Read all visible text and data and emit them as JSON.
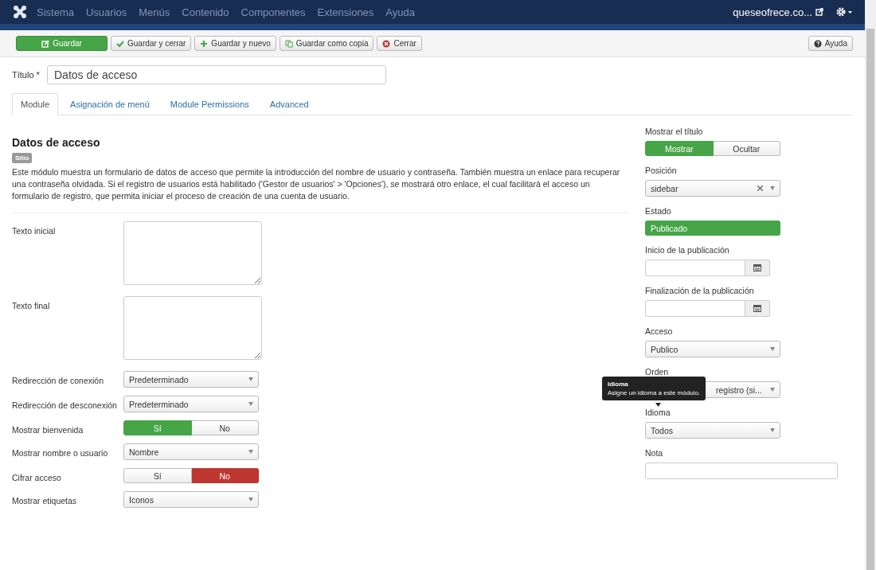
{
  "navbar": {
    "menu": [
      "Sistema",
      "Usuarios",
      "Menús",
      "Contenido",
      "Componentes",
      "Extensiones",
      "Ayuda"
    ],
    "site": "queseofrece.co..."
  },
  "toolbar": {
    "buttons": [
      {
        "label": "Guardar",
        "kind": "primary"
      },
      {
        "label": "Guardar y cerrar",
        "kind": "check"
      },
      {
        "label": "Guardar y nuevo",
        "kind": "plus"
      },
      {
        "label": "Guardar como copia",
        "kind": "copy"
      },
      {
        "label": "Cerrar",
        "kind": "close"
      }
    ],
    "help": "Ayuda"
  },
  "title_field": {
    "label": "Título *",
    "value": "Datos de acceso"
  },
  "tabs": [
    {
      "label": "Module",
      "selected": true
    },
    {
      "label": "Asignación de menú",
      "selected": false
    },
    {
      "label": "Module Permissions",
      "selected": false
    },
    {
      "label": "Advanced",
      "selected": false
    }
  ],
  "module": {
    "heading": "Datos de acceso",
    "badge": "Sitio",
    "description": "Este módulo muestra un formulario de datos de acceso que permite la introducción del nombre de usuario y contraseña. También muestra un enlace para recuperar una contraseña olvidada. Si el registro de usuarios está habilitado ('Gestor de usuarios' > 'Opciones'), se mostrará otro enlace, el cual facilitará el acceso un formulario de registro, que permita iniciar el proceso de creación de una cuenta de usuario."
  },
  "fields": [
    {
      "label": "Texto inicial",
      "kind": "textarea"
    },
    {
      "label": "Texto final",
      "kind": "textarea"
    },
    {
      "label": "Redirección de conexión",
      "kind": "select",
      "value": "Predeterminado"
    },
    {
      "label": "Redirección de desconexión",
      "kind": "select",
      "value": "Predeterminado"
    },
    {
      "label": "Mostrar bienvenida",
      "kind": "toggle",
      "color": "#46a546",
      "options": [
        {
          "label": "Sí",
          "selected": true
        },
        {
          "label": "No",
          "selected": false
        }
      ]
    },
    {
      "label": "Mostrar nombre o usuario",
      "kind": "select",
      "value": "Nombre"
    },
    {
      "label": "Cifrar acceso",
      "kind": "toggle",
      "color": "#bd362f",
      "options": [
        {
          "label": "Sí",
          "selected": false
        },
        {
          "label": "No",
          "selected": true
        }
      ]
    },
    {
      "label": "Mostrar etiquetas",
      "kind": "select",
      "value": "Iconos"
    }
  ],
  "sidebar": [
    {
      "label": "Mostrar el título",
      "kind": "toggle",
      "color": "#46a546",
      "options": [
        {
          "label": "Mostrar",
          "selected": true
        },
        {
          "label": "Ocultar",
          "selected": false
        }
      ]
    },
    {
      "label": "Posición",
      "kind": "select",
      "value": "sidebar",
      "clearable": true
    },
    {
      "label": "Estado",
      "kind": "status",
      "value": "Publicado",
      "color": "#46a546"
    },
    {
      "label": "Inicio de la publicación",
      "kind": "date"
    },
    {
      "label": "Finalización de la publicación",
      "kind": "date"
    },
    {
      "label": "Acceso",
      "kind": "select",
      "value": "Publico"
    },
    {
      "label": "Orden",
      "kind": "select",
      "value": "registro (si...",
      "partly_covered": true
    },
    {
      "label": "Idioma",
      "kind": "select",
      "value": "Todos"
    },
    {
      "label": "Nota",
      "kind": "text"
    }
  ],
  "tooltip": {
    "title": "Idioma",
    "text": "Asigne un idioma a este módulo."
  }
}
